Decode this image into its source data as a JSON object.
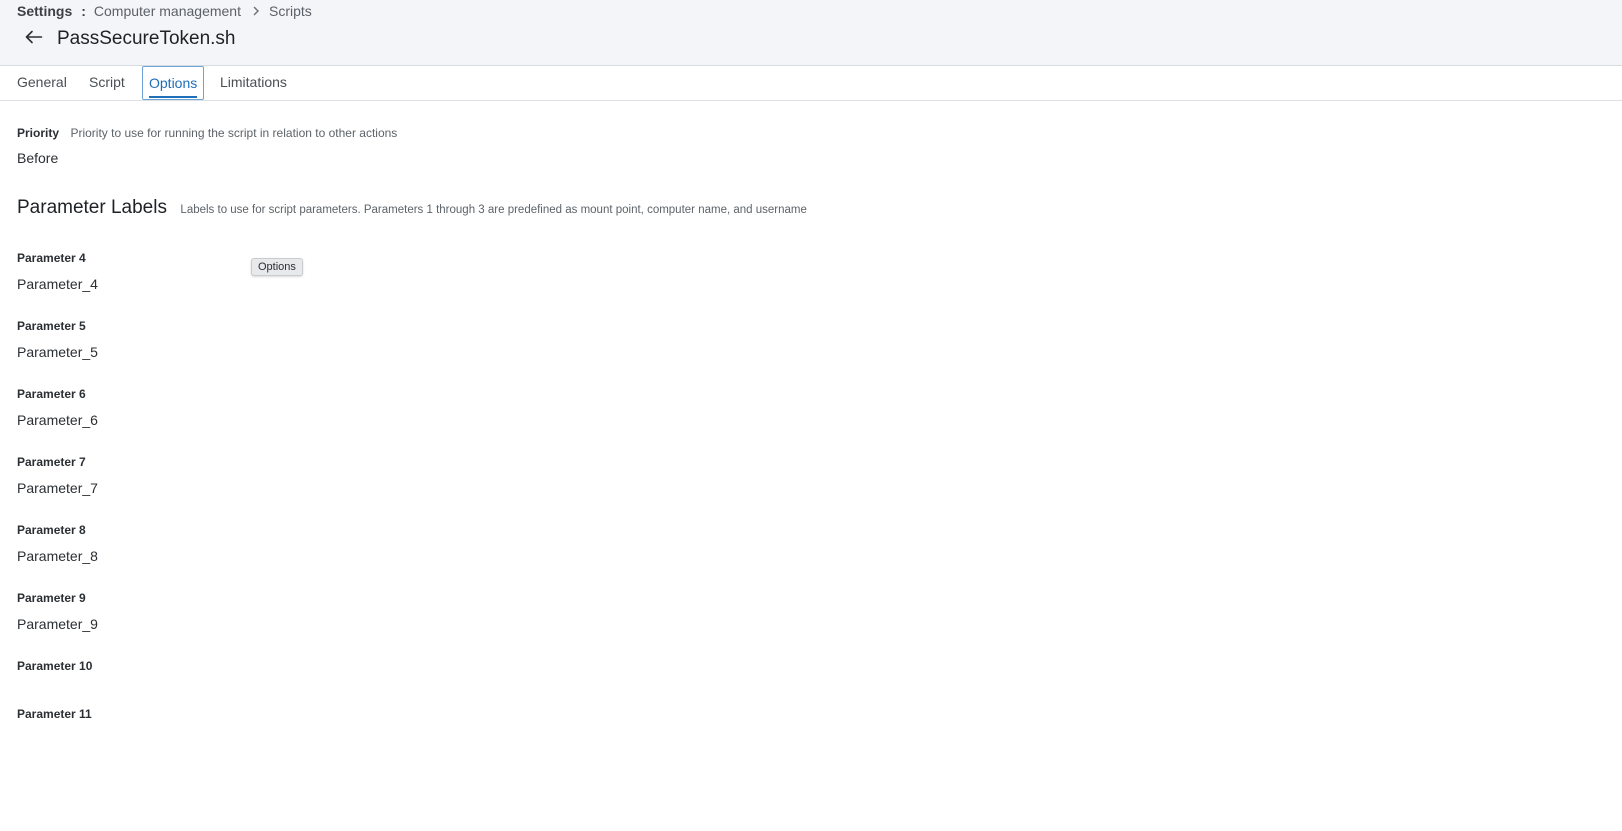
{
  "breadcrumb": {
    "root": "Settings",
    "separator": ":",
    "level1": "Computer management",
    "level2": "Scripts"
  },
  "header": {
    "title": "PassSecureToken.sh"
  },
  "tabs": [
    {
      "label": "General"
    },
    {
      "label": "Script"
    },
    {
      "label": "Options"
    },
    {
      "label": "Limitations"
    }
  ],
  "active_tab": "Options",
  "priority": {
    "label": "Priority",
    "description": "Priority to use for running the script in relation to other actions",
    "value": "Before"
  },
  "parameter_labels": {
    "title": "Parameter Labels",
    "description": "Labels to use for script parameters. Parameters 1 through 3 are predefined as mount point, computer name, and username",
    "items": [
      {
        "label": "Parameter 4",
        "value": "Parameter_4"
      },
      {
        "label": "Parameter 5",
        "value": "Parameter_5"
      },
      {
        "label": "Parameter 6",
        "value": "Parameter_6"
      },
      {
        "label": "Parameter 7",
        "value": "Parameter_7"
      },
      {
        "label": "Parameter 8",
        "value": "Parameter_8"
      },
      {
        "label": "Parameter 9",
        "value": "Parameter_9"
      },
      {
        "label": "Parameter 10",
        "value": ""
      },
      {
        "label": "Parameter 11",
        "value": ""
      }
    ]
  },
  "tooltip": {
    "text": "Options"
  },
  "colors": {
    "accent": "#1f6fb8",
    "header_bg": "#f4f5f8"
  },
  "icons": {
    "back": "arrow-left-icon",
    "breadcrumb_separator": "chevron-right-icon"
  }
}
